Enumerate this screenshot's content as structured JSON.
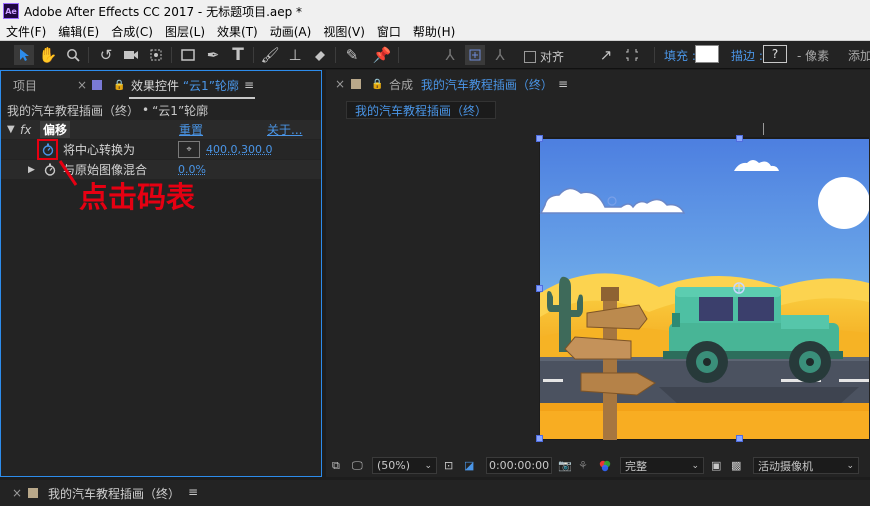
{
  "window": {
    "logo_text": "Ae",
    "title": "Adobe After Effects CC 2017 - 无标题项目.aep *"
  },
  "menu": [
    "文件(F)",
    "编辑(E)",
    "合成(C)",
    "图层(L)",
    "效果(T)",
    "动画(A)",
    "视图(V)",
    "窗口",
    "帮助(H)"
  ],
  "toolbar": {
    "align_label": "对齐",
    "fill_label": "填充 :",
    "stroke_label": "描边 :",
    "stroke_value": "?",
    "pixel_label": "- 像素",
    "add_label": "添加"
  },
  "left_panel": {
    "tab_project": "项目",
    "tab_effects": "效果控件",
    "tab_effects_layer": "“云1”轮廓",
    "subject": "我的汽车教程插画（终）",
    "subject_layer": "“云1”轮廓",
    "effect_name": "偏移",
    "reset_label": "重置",
    "about_label": "关于...",
    "fx_label": "fx",
    "prop1_label": "将中心转换为",
    "prop1_value": "400.0,300.0",
    "prop2_label": "与原始图像混合",
    "prop2_value": "0.0%",
    "annotation": "点击码表"
  },
  "comp_panel": {
    "tab_prefix": "合成",
    "tab_name": "我的汽车教程插画（终）",
    "breadcrumb": "我的汽车教程插画（终）"
  },
  "viewer_bar": {
    "zoom": "(50%)",
    "timecode": "0:00:00:00",
    "quality": "完整",
    "camera": "活动摄像机"
  },
  "timeline": {
    "tab_name": "我的汽车教程插画（终）"
  },
  "colors": {
    "accent_blue": "#2d8ceb",
    "link_blue": "#4a95e6",
    "annotation_red": "#e60012",
    "panel_bg": "#232323"
  }
}
